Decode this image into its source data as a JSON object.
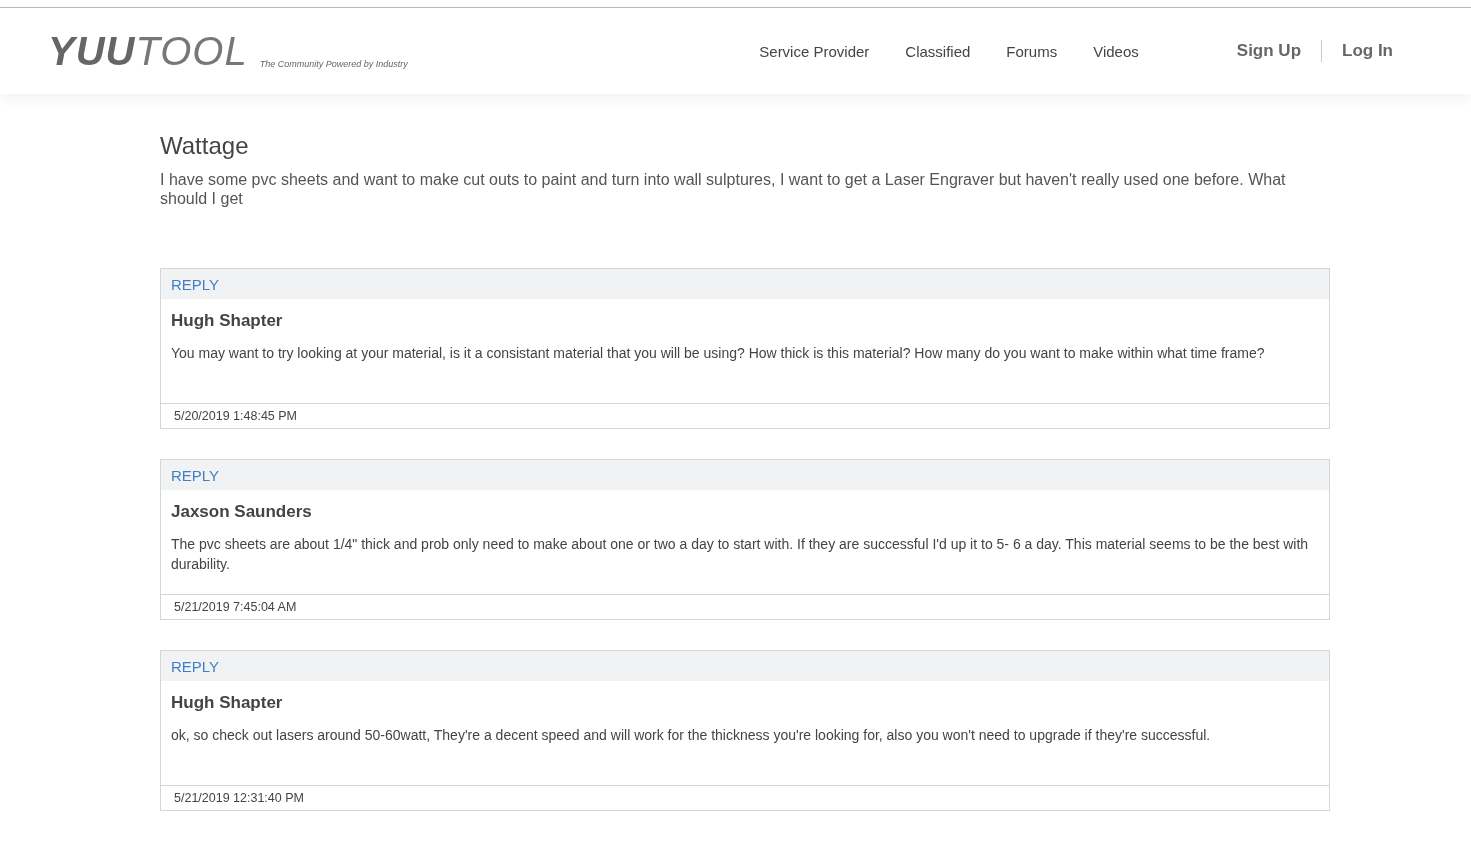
{
  "header": {
    "logo": {
      "bold": "YUU",
      "light": "TOOL"
    },
    "tagline": "The Community Powered by Industry",
    "nav": [
      "Service Provider",
      "Classified",
      "Forums",
      "Videos"
    ],
    "account": [
      "Sign Up",
      "Log In"
    ]
  },
  "question": {
    "title": "Wattage",
    "body": "I have some pvc sheets and want to make cut outs to paint and turn into wall sulptures, I want to get a Laser Engraver but haven't really used one before. What should I get"
  },
  "replies": [
    {
      "action": "REPLY",
      "author": "Hugh Shapter",
      "text": "You may want to try looking at your material, is it a consistant material that you will be using? How thick is this material? How many do you want to make within what time frame?",
      "date": "5/20/2019 1:48:45 PM"
    },
    {
      "action": "REPLY",
      "author": "Jaxson Saunders",
      "text": "The pvc sheets are about 1/4\" thick and prob only need to make about one or two a day to start with. If they are successful I'd up it to 5- 6 a day. This material seems to be the best with durability.",
      "date": "5/21/2019 7:45:04 AM"
    },
    {
      "action": "REPLY",
      "author": "Hugh Shapter",
      "text": "ok, so check out lasers around 50-60watt, They're a decent speed and will work for the thickness you're looking for, also you won't need to upgrade if they're successful.",
      "date": "5/21/2019 12:31:40 PM"
    }
  ]
}
